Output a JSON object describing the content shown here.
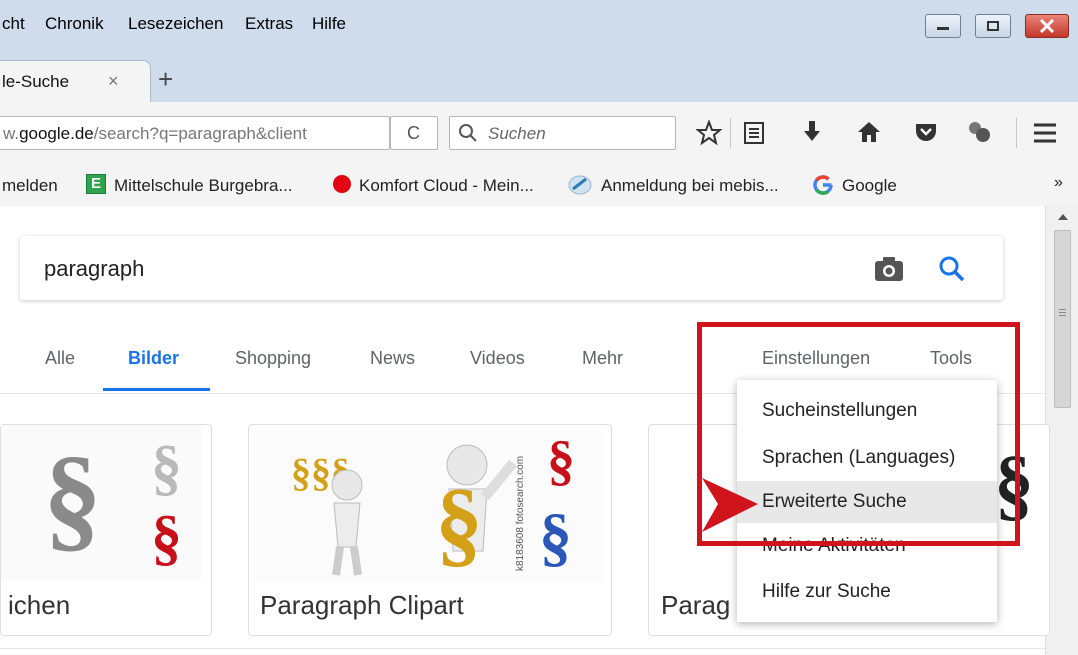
{
  "menubar": {
    "items": [
      "cht",
      "Chronik",
      "Lesezeichen",
      "Extras",
      "Hilfe"
    ]
  },
  "tabs": {
    "active_title": "le-Suche",
    "close": "×",
    "new_tab": "+"
  },
  "navbar": {
    "url_prefix": "w.",
    "url_domain": "google.de",
    "url_rest": "/search?q=paragraph&client",
    "reload": "C",
    "search_placeholder": "Suchen"
  },
  "bookmarks": {
    "items": [
      "melden",
      "Mittelschule Burgebra...",
      "Komfort Cloud - Mein...",
      "Anmeldung bei mebis...",
      "Google"
    ],
    "overflow": "»"
  },
  "google": {
    "query": "paragraph",
    "tabs": [
      "Alle",
      "Bilder",
      "Shopping",
      "News",
      "Videos",
      "Mehr"
    ],
    "active_tab": "Bilder",
    "settings": "Einstellungen",
    "tools": "Tools",
    "dropdown": [
      "Sucheinstellungen",
      "Sprachen  (Languages)",
      "Erweiterte Suche",
      "Meine Aktivitäten",
      "Hilfe zur Suche"
    ],
    "highlighted_item": "Erweiterte Suche"
  },
  "results": {
    "captions": [
      "ichen",
      "Paragraph Clipart",
      "Parag"
    ],
    "watermark": "k8183608 fotosearch.com"
  },
  "colors": {
    "accent": "#1a73e8",
    "annotation_red": "#d0141c",
    "menubar": "#cfdcec",
    "highlight": "#e8e8e8"
  }
}
